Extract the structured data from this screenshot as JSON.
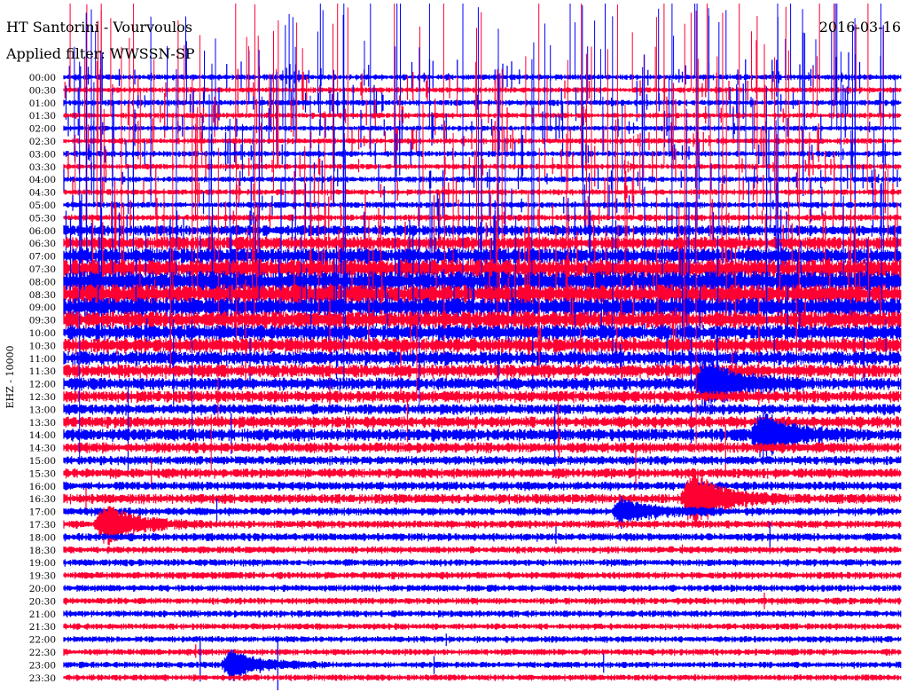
{
  "chart_data": {
    "type": "line",
    "title": "HT Santorini - Vourvoulos",
    "date": "2016-03-16",
    "filter_label": "Applied filter: WWSSN-SP",
    "ylabel": "EHZ - 10000",
    "colors": [
      "#0000ff",
      "#ff0033"
    ],
    "y_tick_labels": [
      "00:00",
      "00:30",
      "01:00",
      "01:30",
      "02:00",
      "02:30",
      "03:00",
      "03:30",
      "04:00",
      "04:30",
      "05:00",
      "05:30",
      "06:00",
      "06:30",
      "07:00",
      "07:30",
      "08:00",
      "08:30",
      "09:00",
      "09:30",
      "10:00",
      "10:30",
      "11:00",
      "11:30",
      "12:00",
      "12:30",
      "13:00",
      "13:30",
      "14:00",
      "14:30",
      "15:00",
      "15:30",
      "16:00",
      "16:30",
      "17:00",
      "17:30",
      "18:00",
      "18:30",
      "19:00",
      "19:30",
      "20:00",
      "20:30",
      "21:00",
      "21:30",
      "22:00",
      "22:30",
      "23:00",
      "23:30"
    ],
    "trace_noise_level": [
      3.2,
      3.1,
      3.3,
      3.2,
      3.0,
      3.2,
      3.3,
      3.1,
      3.2,
      3.3,
      3.4,
      3.6,
      6.0,
      7.5,
      9.0,
      11.0,
      12.0,
      11.5,
      11.0,
      10.0,
      9.0,
      8.5,
      8.0,
      7.5,
      7.0,
      6.5,
      6.0,
      6.5,
      7.0,
      6.0,
      5.0,
      5.5,
      5.0,
      5.5,
      4.5,
      4.5,
      4.5,
      4.0,
      4.0,
      4.0,
      3.8,
      3.8,
      3.8,
      3.6,
      3.6,
      3.6,
      3.6,
      3.5
    ],
    "tall_spike_level": [
      0.9,
      0.85,
      0.8,
      0.75,
      0.8,
      0.85,
      0.8,
      0.75,
      0.8,
      0.75,
      0.7,
      0.65,
      0.6,
      0.55,
      0.5,
      0.45,
      0.4,
      0.35,
      0.3,
      0.25,
      0.2,
      0.15,
      0.1,
      0.1,
      0.05,
      0.05,
      0.05,
      0.04,
      0.04,
      0.03,
      0.03,
      0.03,
      0.02,
      0.02,
      0.02,
      0.02,
      0.02,
      0.02,
      0.02,
      0.02,
      0.02,
      0.02,
      0.02,
      0.02,
      0.02,
      0.02,
      0.02,
      0.02
    ],
    "events": [
      {
        "trace": "16:30",
        "time_min": 22.5,
        "amplitude": 30
      },
      {
        "trace": "14:00",
        "time_min": 25.0,
        "amplitude": 24
      },
      {
        "trace": "17:30",
        "time_min": 1.5,
        "amplitude": 22
      },
      {
        "trace": "17:00",
        "time_min": 20.0,
        "amplitude": 14
      },
      {
        "trace": "12:00",
        "time_min": 23.0,
        "amplitude": 28
      },
      {
        "trace": "23:00",
        "time_min": 6.0,
        "amplitude": 16
      }
    ]
  }
}
